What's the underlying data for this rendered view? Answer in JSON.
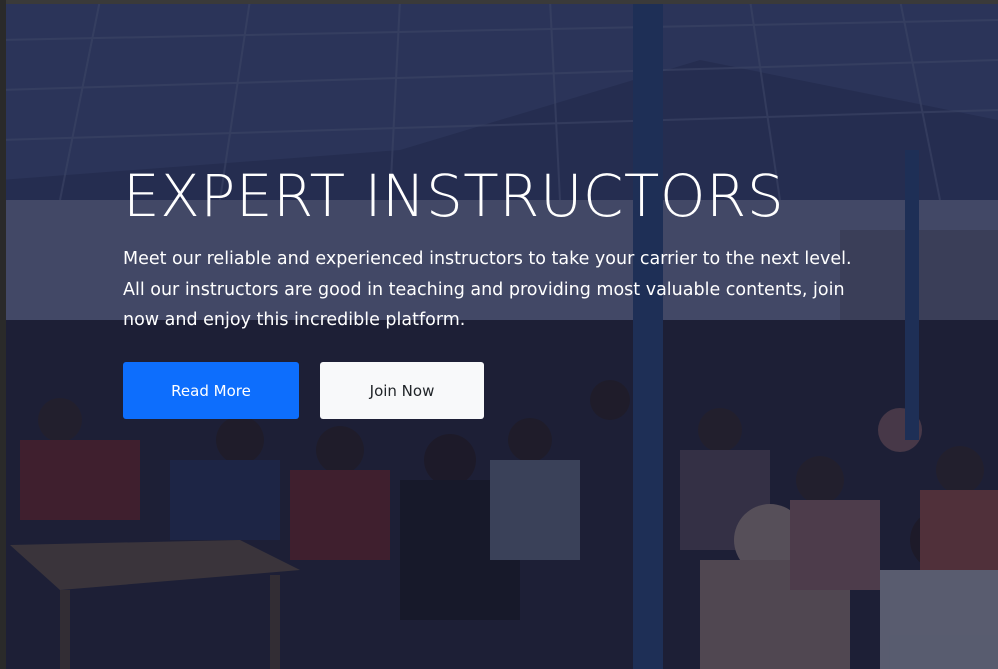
{
  "hero": {
    "title": "EXPERT INSTRUCTORS",
    "description": "Meet our reliable and experienced instructors to take your carrier to the next level. All our instructors are good in teaching and providing most valuable contents, join now and enjoy this incredible platform.",
    "primary_button": "Read More",
    "secondary_button": "Join Now"
  },
  "colors": {
    "primary": "#0d6efd",
    "light": "#f8f9fa",
    "overlay": "#121630"
  }
}
